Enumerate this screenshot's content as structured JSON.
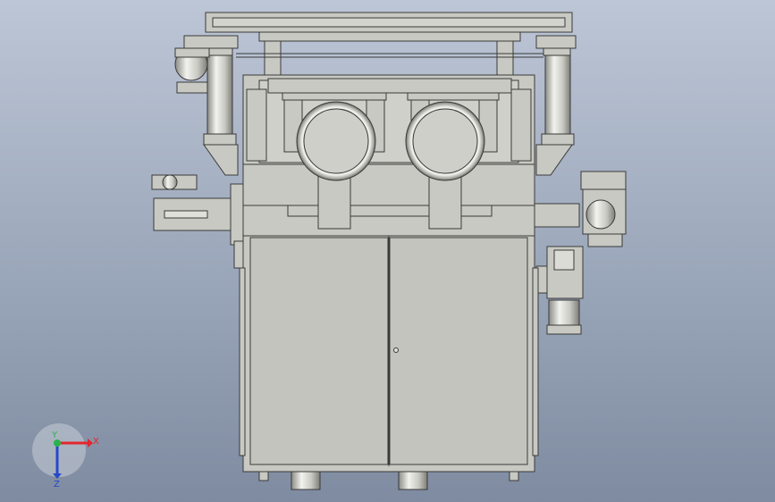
{
  "viewport": {
    "background_top": "#bdc6d6",
    "background_bottom": "#7f8ba0"
  },
  "model": {
    "body_fill": "#c9c9c3",
    "body_stroke": "#3a3a3a",
    "cylinder_light": "#f2f2ee",
    "cylinder_dark": "#8c8c86"
  },
  "triad": {
    "x_label": "X",
    "y_label": "Y",
    "z_label": "Z",
    "x_color": "#e3262b",
    "y_color": "#2ab34a",
    "z_color": "#2748c9"
  }
}
